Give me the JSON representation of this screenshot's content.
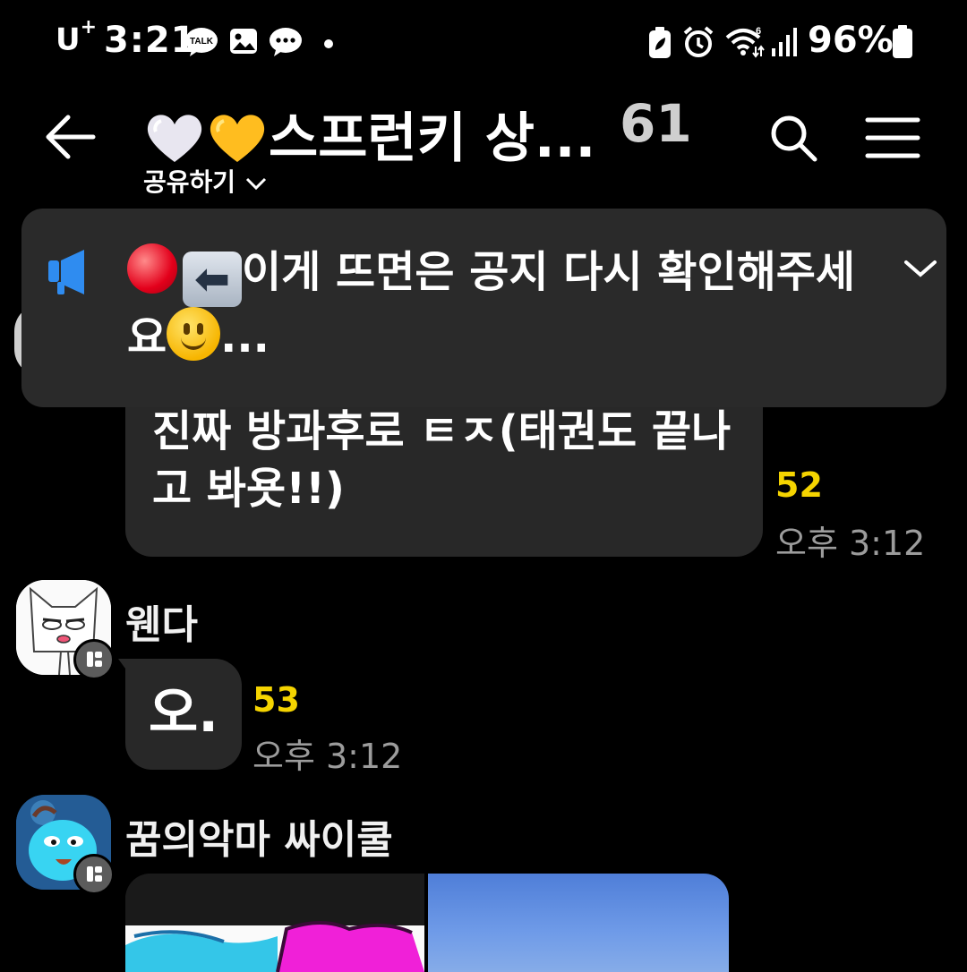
{
  "status_bar": {
    "carrier": "U",
    "carrier_sup": "+",
    "time": "3:21",
    "battery_percent": "96%",
    "left_icons": [
      "talk-icon",
      "gallery-icon",
      "message-icon",
      "dot-icon"
    ],
    "right_icons": [
      "battery-saver-icon",
      "alarm-icon",
      "wifi-icon",
      "signal-icon",
      "battery-icon"
    ]
  },
  "header": {
    "title": "스프런키 상...",
    "title_emojis": [
      "white-heart-icon",
      "yellow-heart-icon"
    ],
    "member_count": "61",
    "share_label": "공유하기"
  },
  "notice": {
    "text": "이게 뜨면은 공지 다시 확인해주세요",
    "ellipsis": "..."
  },
  "messages": [
    {
      "text": "진짜 방과후로 ㅌㅈ(태권도 끝나고 봐욧!!)",
      "unread": "52",
      "time": "오후 3:12"
    },
    {
      "sender": "웬다",
      "text": "오.",
      "unread": "53",
      "time": "오후 3:12"
    },
    {
      "sender": "꿈의악마 싸이쿨"
    }
  ],
  "colors": {
    "background": "#000000",
    "bubble": "#282828",
    "notice": "#2a2a2a",
    "unread": "#f5d400",
    "timestamp": "#9c9c9c",
    "notice_icon": "#2f8cf0"
  }
}
